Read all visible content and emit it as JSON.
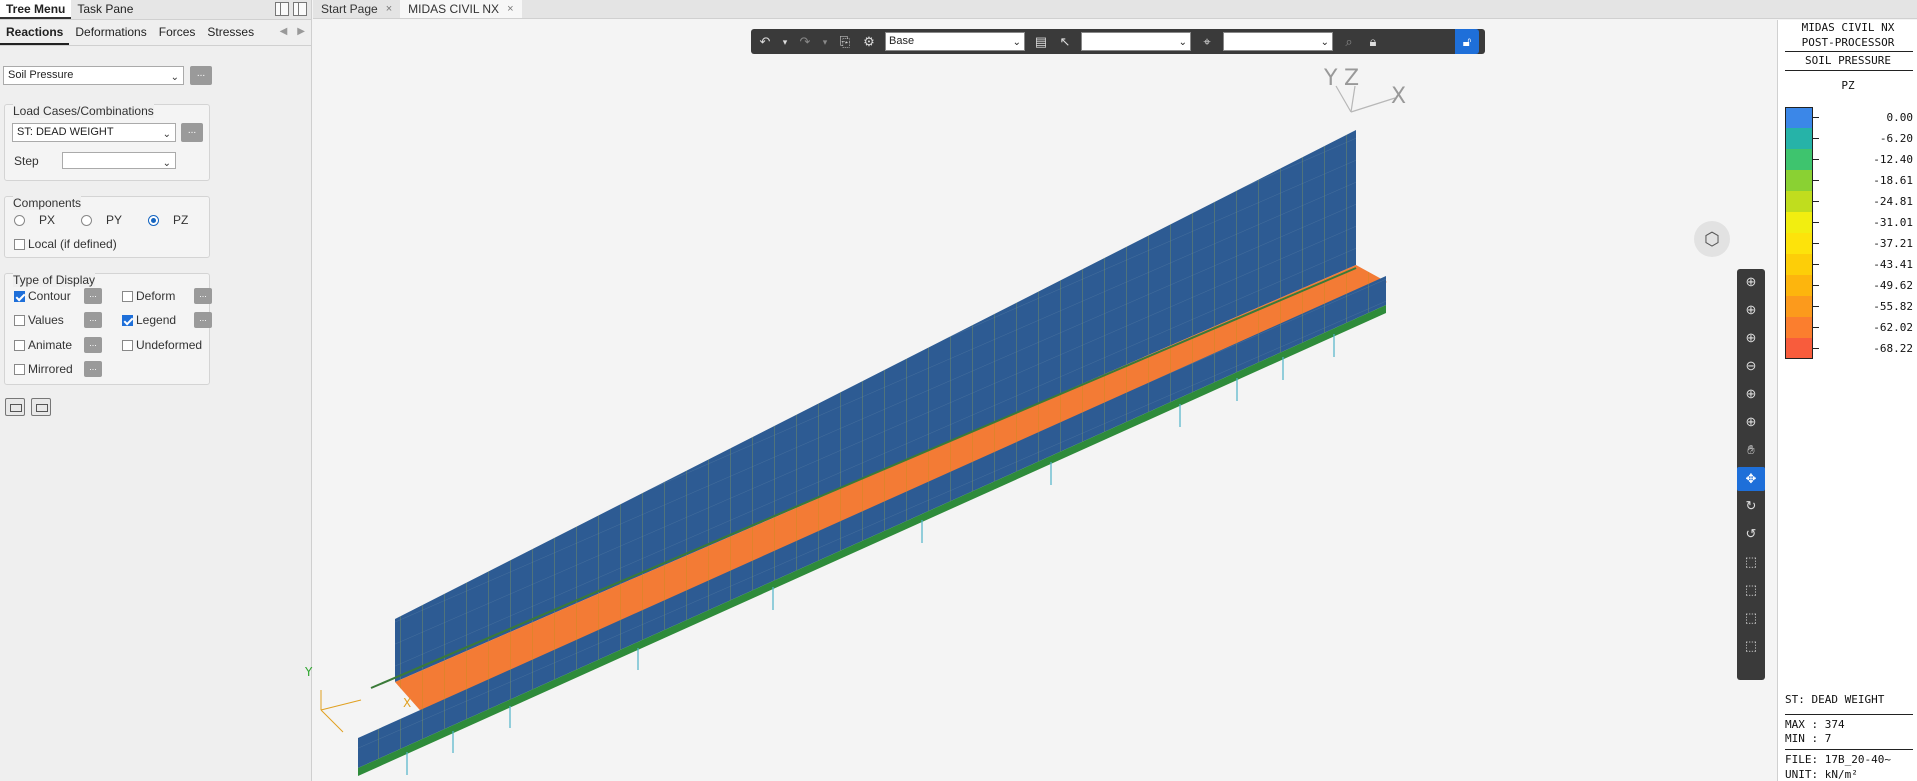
{
  "left_panel": {
    "top_tabs": [
      "Tree Menu",
      "Task Pane"
    ],
    "category_tabs": [
      "Reactions",
      "Deformations",
      "Forces",
      "Stresses"
    ],
    "result_type": "Soil Pressure",
    "load_group_title": "Load Cases/Combinations",
    "load_case": "ST: DEAD WEIGHT",
    "step_label": "Step",
    "step_value": "",
    "components_title": "Components",
    "components": [
      "PX",
      "PY",
      "PZ"
    ],
    "selected_component": "PZ",
    "local_label": "Local (if defined)",
    "display_title": "Type of Display",
    "display_options": {
      "contour": "Contour",
      "deform": "Deform",
      "values": "Values",
      "legend": "Legend",
      "animate": "Animate",
      "undeformed": "Undeformed",
      "mirrored": "Mirrored"
    },
    "dots": "..."
  },
  "doc_tabs": [
    {
      "label": "Start Page",
      "close": "×"
    },
    {
      "label": "MIDAS CIVIL NX",
      "close": "×"
    }
  ],
  "toolbar": {
    "view_select": "Base",
    "select2": "",
    "select3": ""
  },
  "axes": {
    "y": "Y",
    "z": "Z",
    "x": "X",
    "origin_y": "Y",
    "origin_x": "X"
  },
  "legend": {
    "title1": "MIDAS CIVIL NX",
    "title2": "POST-PROCESSOR",
    "title3": "SOIL PRESSURE",
    "component": "PZ",
    "levels": [
      {
        "value": "0.00",
        "color": "#3b87e8"
      },
      {
        "value": "-6.20",
        "color": "#26b3a8"
      },
      {
        "value": "-12.40",
        "color": "#3ec46e"
      },
      {
        "value": "-18.61",
        "color": "#8ad133"
      },
      {
        "value": "-24.81",
        "color": "#c0dd1e"
      },
      {
        "value": "-31.01",
        "color": "#f2ee10"
      },
      {
        "value": "-37.21",
        "color": "#fde30b"
      },
      {
        "value": "-43.41",
        "color": "#fdce08"
      },
      {
        "value": "-49.62",
        "color": "#fdb50d"
      },
      {
        "value": "-55.82",
        "color": "#fc9a1c"
      },
      {
        "value": "-62.02",
        "color": "#fb7e2e"
      },
      {
        "value": "-68.22",
        "color": "#f85c3c"
      }
    ],
    "load_case": "ST: DEAD WEIGHT",
    "max": "MAX : 374",
    "min": "MIN : 7",
    "file": "FILE: 17B_20-40~",
    "unit": "UNIT: kN/m²"
  }
}
